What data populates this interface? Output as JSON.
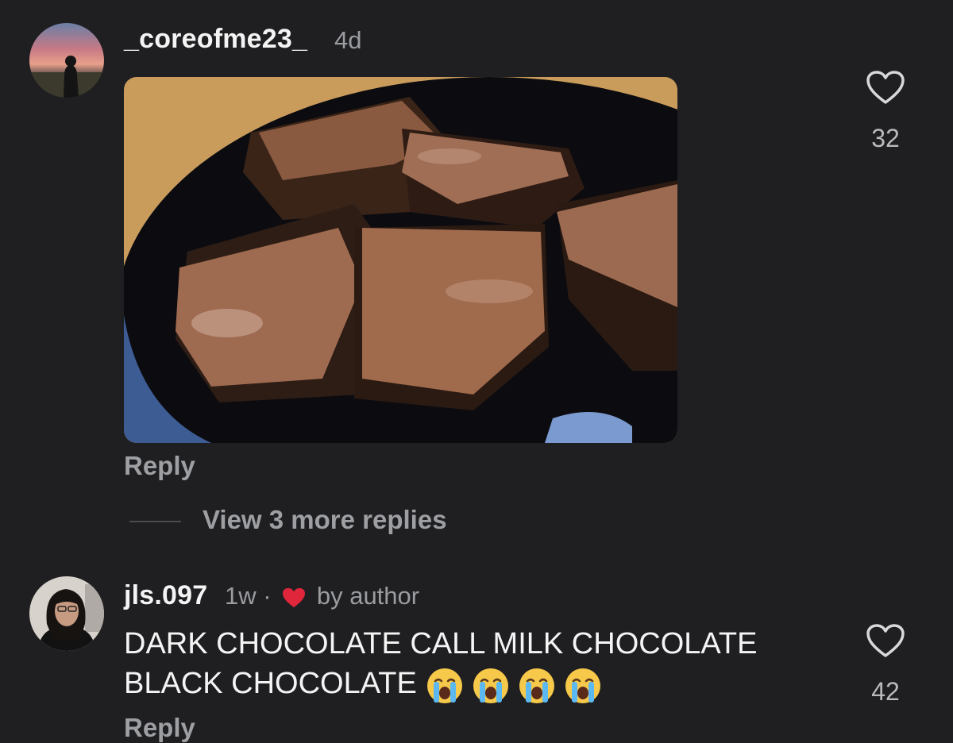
{
  "comment1": {
    "username": "_coreofme23_",
    "time": "4d",
    "reply_label": "Reply",
    "like_count": "32",
    "like_icon": "heart-outline-icon"
  },
  "thread": {
    "view_more_label": "View 3 more replies"
  },
  "comment2": {
    "username": "jls.097",
    "time": "1w",
    "separator": "·",
    "author_badge": "by author",
    "author_badge_icon": "heart-filled-icon",
    "author_badge_color": "#e0263a",
    "text": "DARK CHOCOLATE CALL MILK CHOCOLATE BLACK CHOCOLATE",
    "emoji": [
      "crying-face",
      "crying-face",
      "crying-face",
      "crying-face"
    ],
    "reply_label": "Reply",
    "like_count": "42",
    "like_icon": "heart-outline-icon"
  },
  "colors": {
    "background": "#1f1f22",
    "secondary_text": "#9d9fa3"
  }
}
